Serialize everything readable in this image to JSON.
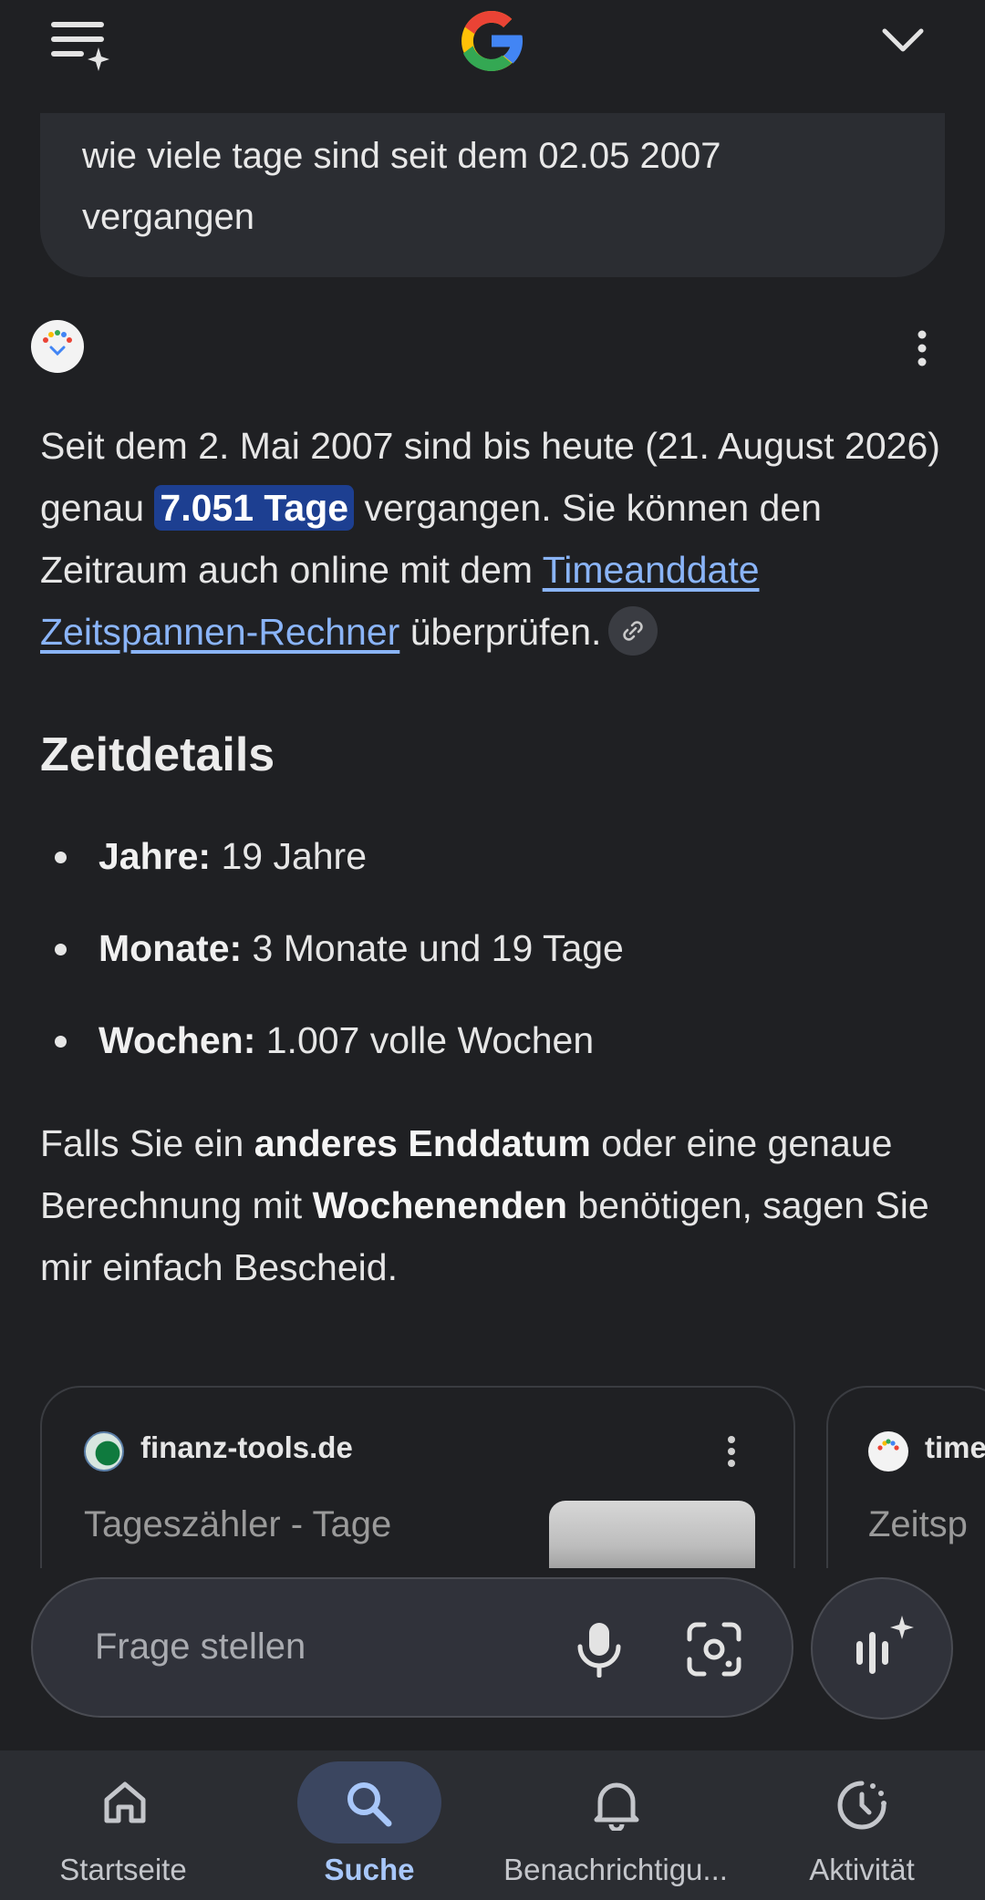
{
  "header": {
    "logo": "google-g-logo",
    "menu_icon": "menu-sparkle-icon",
    "collapse_icon": "chevron-down-icon"
  },
  "query": {
    "text": "wie viele tage sind seit dem 02.05 2007 vergangen"
  },
  "answer": {
    "p1_before": "Seit dem 2. Mai 2007 sind bis heute (21. August 2026) genau ",
    "highlight": "7.051 Tage",
    "p1_middle": " vergangen. Sie können den Zeitraum auch online mit dem ",
    "link_text": "Timeanddate Zeitspannen-Rechner",
    "p1_after": " überprüfen."
  },
  "section": {
    "title": "Zeitdetails",
    "items": [
      {
        "label": "Jahre:",
        "value": " 19 Jahre"
      },
      {
        "label": "Monate:",
        "value": " 3 Monate und 19 Tage"
      },
      {
        "label": "Wochen:",
        "value": " 1.007 volle Wochen"
      }
    ]
  },
  "closing": {
    "t1": "Falls Sie ein ",
    "b1": "anderes Enddatum",
    "t2": " oder eine genaue Berechnung mit ",
    "b2": "Wochenenden",
    "t3": " benötigen, sagen Sie mir einfach Bescheid."
  },
  "sources": [
    {
      "site": "finanz-tools.de",
      "title": "Tageszähler - Tage"
    },
    {
      "site": "time",
      "title": "Zeitsp"
    }
  ],
  "ask": {
    "placeholder": "Frage stellen"
  },
  "nav": {
    "home": "Startseite",
    "search": "Suche",
    "notifications": "Benachrichtigu...",
    "activity": "Aktivität"
  },
  "colors": {
    "background": "#1f2023",
    "highlight": "#1d3f91",
    "link": "#8ab4f8",
    "active_nav": "#a8c7fa"
  }
}
